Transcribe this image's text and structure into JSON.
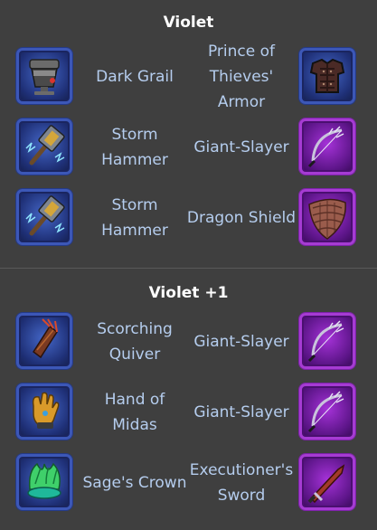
{
  "sections": [
    {
      "title": "Violet",
      "rows": [
        {
          "left": {
            "name": "Dark Grail",
            "icon": "dark-grail-icon"
          },
          "right": {
            "name": "Prince of Thieves' Armor",
            "icon": "prince-of-thieves-armor-icon"
          }
        },
        {
          "left": {
            "name": "Storm Hammer",
            "icon": "storm-hammer-icon"
          },
          "right": {
            "name": "Giant-Slayer",
            "icon": "giant-slayer-icon"
          }
        },
        {
          "left": {
            "name": "Storm Hammer",
            "icon": "storm-hammer-icon"
          },
          "right": {
            "name": "Dragon Shield",
            "icon": "dragon-shield-icon"
          }
        }
      ]
    },
    {
      "title": "Violet +1",
      "rows": [
        {
          "left": {
            "name": "Scorching Quiver",
            "icon": "scorching-quiver-icon"
          },
          "right": {
            "name": "Giant-Slayer",
            "icon": "giant-slayer-icon"
          }
        },
        {
          "left": {
            "name": "Hand of Midas",
            "icon": "hand-of-midas-icon"
          },
          "right": {
            "name": "Giant-Slayer",
            "icon": "giant-slayer-icon"
          }
        },
        {
          "left": {
            "name": "Sage's Crown",
            "icon": "sages-crown-icon"
          },
          "right": {
            "name": "Executioner's Sword",
            "icon": "executioners-sword-icon"
          }
        }
      ]
    }
  ],
  "colors": {
    "background": "#3f3f3f",
    "title": "#ffffff",
    "item_label": "#b5cdee",
    "blue_frame": "#3c57b7",
    "purple_frame": "#a63bd3"
  }
}
